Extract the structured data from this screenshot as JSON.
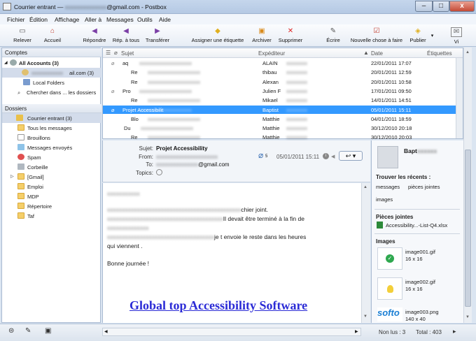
{
  "window": {
    "title_prefix": "Courrier entrant — ",
    "title_suffix": "@gmail.com - Postbox",
    "minimize": "–",
    "maximize": "□",
    "close": "x"
  },
  "menu": [
    "Fichier",
    "Édition",
    "Affichage",
    "Aller à",
    "Messages",
    "Outils",
    "Aide"
  ],
  "toolbar": {
    "relever": "Relever",
    "accueil": "Accueil",
    "repondre": "Répondre",
    "rep_tous": "Rép. à tous",
    "transferer": "Transférer",
    "etiquette": "Assigner une étiquette",
    "archiver": "Archiver",
    "supprimer": "Supprimer",
    "ecrire": "Écrire",
    "nouvelle": "Nouvelle chose à faire",
    "publier": "Publier",
    "vue": "Vi"
  },
  "folders": {
    "comptes_header": "Comptes",
    "all_accounts": "All Accounts (3)",
    "gmail_account": "ail.com (3)",
    "local_folders": "Local Folders",
    "search": "Chercher dans ... les dossiers",
    "dossiers_header": "Dossiers",
    "items": [
      "Courrier entrant (3)",
      "Tous les messages",
      "Brouillons",
      "Messages envoyés",
      "Spam",
      "Corbeille",
      "[Gmail]",
      "Emploi",
      "MDP",
      "Répertoire",
      "Taf"
    ]
  },
  "thread": {
    "col_subject": "Sujet",
    "col_from": "Expéditeur",
    "col_date": "Date",
    "col_tags": "Étiquettes",
    "rows": [
      {
        "subject": "aq",
        "from": "ALAIN",
        "date": "22/01/2011 17:07"
      },
      {
        "subject": "Re",
        "from": "thibau",
        "date": "20/01/2011 12:59"
      },
      {
        "subject": "Re",
        "from": "Alexan",
        "date": "20/01/2011 10:58"
      },
      {
        "subject": "Pro",
        "from": "Julien F",
        "date": "17/01/2011 09:50"
      },
      {
        "subject": "Re",
        "from": "Mikael",
        "date": "14/01/2011 14:51"
      },
      {
        "subject": "Projet Accessibilit",
        "from": "Baptist",
        "date": "05/01/2011 15:11"
      },
      {
        "subject": "Blo",
        "from": "Matthie",
        "date": "04/01/2011 18:59"
      },
      {
        "subject": "Du",
        "from": "Matthie",
        "date": "30/12/2010 20:18"
      },
      {
        "subject": "Re",
        "from": "Matthie",
        "date": "30/12/2010 20:03"
      },
      {
        "subject": "",
        "from": "Matthi",
        "date": ""
      }
    ]
  },
  "header": {
    "subject_label": "Sujet:",
    "subject": "Projet Accessibility",
    "from_label": "From:",
    "to_label": "To:",
    "to_value": "@gmail.com",
    "topics_label": "Topics:",
    "date": "05/01/2011 15:11",
    "attach_count": "5"
  },
  "body": {
    "line1": "chier joint.",
    "line2": "Il devait être terminé à la fin de",
    "line3": "je t envoie le reste dans les heures",
    "line4": "qui viennent .",
    "line5": "Bonne journée !",
    "link": "Global top Accessibility Software"
  },
  "side": {
    "contact": "Bapt",
    "recent_title": "Trouver les récents :",
    "messages": "messages",
    "pieces": "pièces jointes",
    "images": "images",
    "attachments_title": "Pièces jointes",
    "attachment": "Accessibility...-List-Q4.xlsx",
    "images_title": "Images",
    "imgs": [
      {
        "name": "image001.gif",
        "size": "16 x 16"
      },
      {
        "name": "image002.gif",
        "size": "16 x 16"
      },
      {
        "name": "image003.png",
        "size": "140 x 40"
      }
    ]
  },
  "status": {
    "non_lus": "Non lus : 3",
    "total": "Total : 403"
  }
}
